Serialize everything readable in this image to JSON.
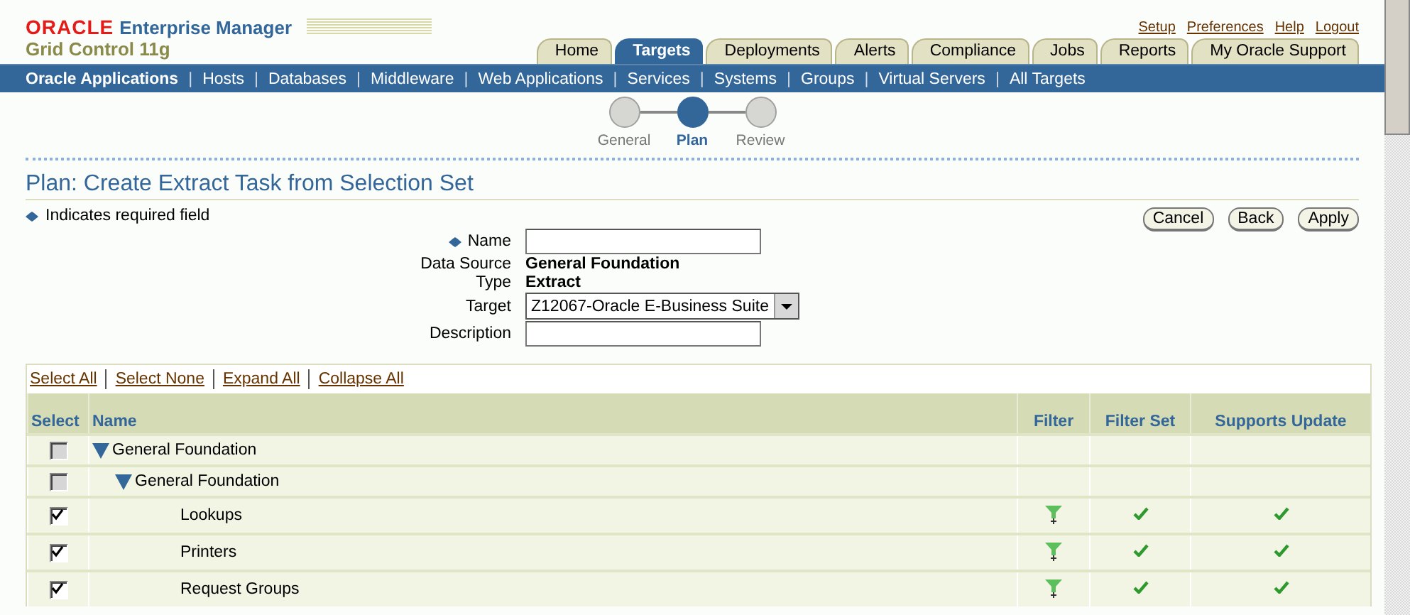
{
  "header": {
    "brand": "ORACLE",
    "product": "Enterprise Manager",
    "subtitle": "Grid Control 11g"
  },
  "global_links": [
    "Setup",
    "Preferences",
    "Help",
    "Logout"
  ],
  "tabs": [
    {
      "label": "Home",
      "selected": false
    },
    {
      "label": "Targets",
      "selected": true
    },
    {
      "label": "Deployments",
      "selected": false
    },
    {
      "label": "Alerts",
      "selected": false
    },
    {
      "label": "Compliance",
      "selected": false
    },
    {
      "label": "Jobs",
      "selected": false
    },
    {
      "label": "Reports",
      "selected": false
    },
    {
      "label": "My Oracle Support",
      "selected": false
    }
  ],
  "subtabs": [
    {
      "label": "Oracle Applications",
      "selected": true
    },
    {
      "separator": "|",
      "label": "Hosts",
      "selected": false
    },
    {
      "separator": "|",
      "label": "Databases",
      "selected": false
    },
    {
      "separator": "|",
      "label": "Middleware",
      "selected": false
    },
    {
      "separator": "|",
      "label": "Web Applications",
      "selected": false
    },
    {
      "separator": "|",
      "label": "Services",
      "selected": false
    },
    {
      "separator": "|",
      "label": "Systems",
      "selected": false
    },
    {
      "separator": "|",
      "label": "Groups",
      "selected": false
    },
    {
      "separator": "|",
      "label": "Virtual Servers",
      "selected": false
    },
    {
      "separator": "|",
      "label": "All Targets",
      "selected": false
    }
  ],
  "train": [
    {
      "label": "General",
      "selected": false
    },
    {
      "label": "Plan",
      "selected": true
    },
    {
      "label": "Review",
      "selected": false
    }
  ],
  "page_title": "Plan: Create Extract Task from Selection Set",
  "required_note": "Indicates required field",
  "buttons": [
    "Cancel",
    "Back",
    "Apply"
  ],
  "form": [
    {
      "kind": "input",
      "label": "Name",
      "required": true
    },
    {
      "kind": "text",
      "label": "Data Source",
      "value": "General Foundation"
    },
    {
      "kind": "text",
      "label": "Type",
      "value": "Extract"
    },
    {
      "kind": "select",
      "label": "Target",
      "value": "Z12067-Oracle E-Business Suite"
    },
    {
      "kind": "input",
      "label": "Description",
      "required": false
    }
  ],
  "table_actions": [
    "Select All",
    "Select None",
    "Expand All",
    "Collapse All"
  ],
  "table": {
    "columns": [
      "Select",
      "Name",
      "Filter",
      "Filter Set",
      "Supports Update"
    ],
    "rows": [
      {
        "name": "General Foundation",
        "checked": false,
        "disabled": true,
        "expanded": true,
        "filter": false,
        "filter_set": false,
        "supports_update": false,
        "children": [
          {
            "name": "General Foundation",
            "checked": false,
            "disabled": true,
            "expanded": true,
            "filter": false,
            "filter_set": false,
            "supports_update": false,
            "children": [
              {
                "name": "Lookups",
                "checked": true,
                "disabled": false,
                "filter": true,
                "filter_set": true,
                "supports_update": true
              },
              {
                "name": "Printers",
                "checked": true,
                "disabled": false,
                "filter": true,
                "filter_set": true,
                "supports_update": true
              },
              {
                "name": "Request Groups",
                "checked": true,
                "disabled": false,
                "filter": true,
                "filter_set": true,
                "supports_update": true
              }
            ]
          }
        ]
      }
    ]
  }
}
